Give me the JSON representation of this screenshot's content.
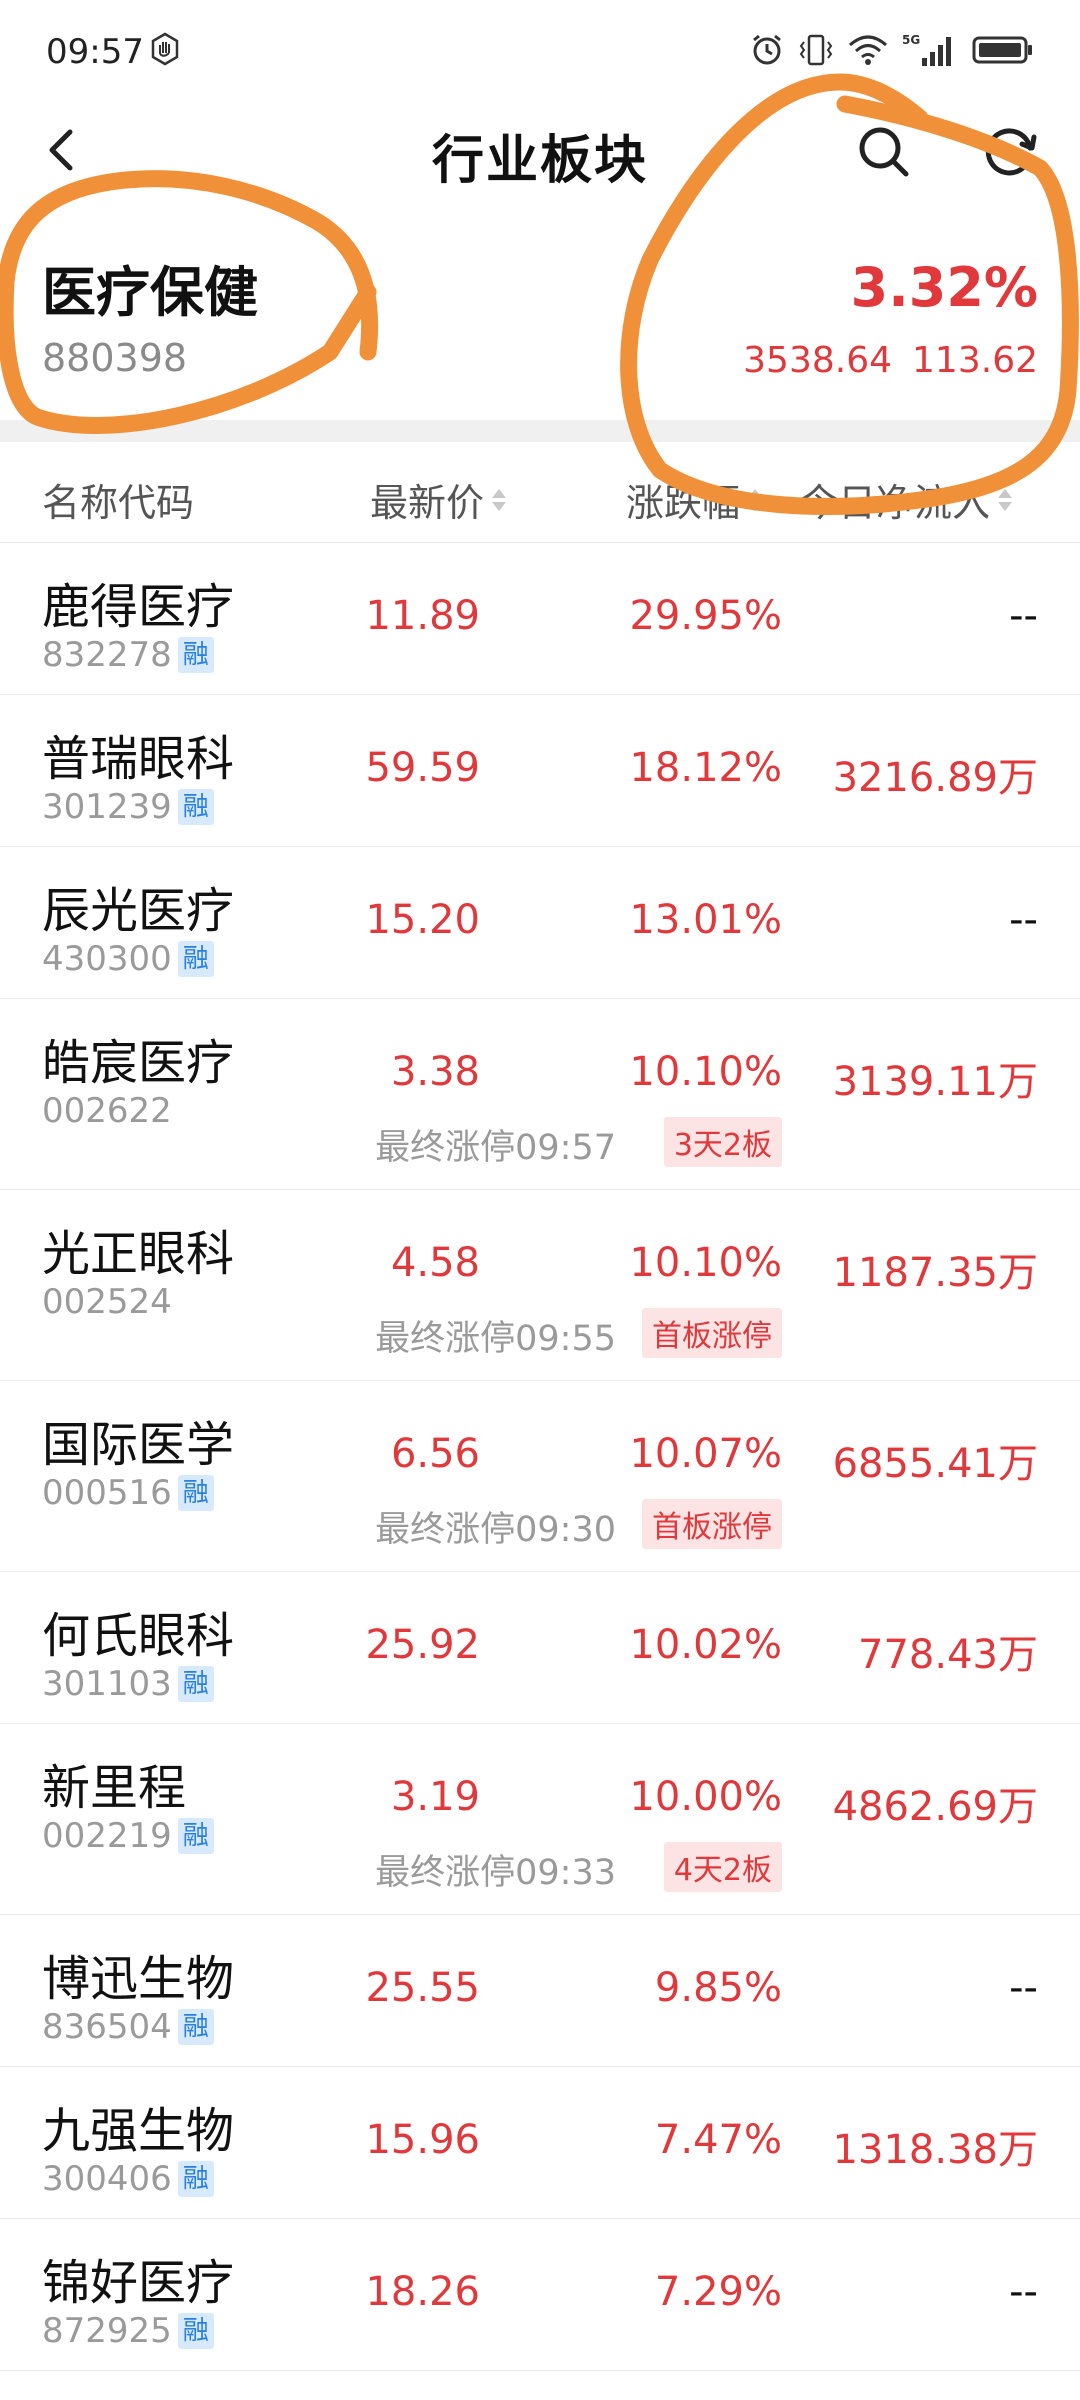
{
  "status_bar": {
    "time": "09:57",
    "icons": [
      "hand-icon",
      "alarm-icon",
      "vibrate-icon",
      "wifi-icon",
      "signal-5g-icon",
      "battery-icon"
    ]
  },
  "nav": {
    "title": "行业板块",
    "icons": {
      "back": "chevron-left-icon",
      "search": "search-icon",
      "refresh": "refresh-icon"
    }
  },
  "sector": {
    "name": "医疗保健",
    "code": "880398",
    "change_pct": "3.32%",
    "price": "3538.64",
    "change": "113.62"
  },
  "table_header": {
    "name_code": "名称代码",
    "latest_price": "最新价",
    "change_pct": "涨跌幅",
    "net_inflow": "今日净流入"
  },
  "rows": [
    {
      "name": "鹿得医疗",
      "code": "832278",
      "badge": "融",
      "price": "11.89",
      "pct": "29.95%",
      "flow": "--"
    },
    {
      "name": "普瑞眼科",
      "code": "301239",
      "badge": "融",
      "price": "59.59",
      "pct": "18.12%",
      "flow": "3216.89万"
    },
    {
      "name": "辰光医疗",
      "code": "430300",
      "badge": "融",
      "price": "15.20",
      "pct": "13.01%",
      "flow": "--"
    },
    {
      "name": "皓宸医疗",
      "code": "002622",
      "badge": "",
      "price": "3.38",
      "pct": "10.10%",
      "flow": "3139.11万",
      "note": "最终涨停09:57",
      "tag": "3天2板"
    },
    {
      "name": "光正眼科",
      "code": "002524",
      "badge": "",
      "price": "4.58",
      "pct": "10.10%",
      "flow": "1187.35万",
      "note": "最终涨停09:55",
      "tag": "首板涨停"
    },
    {
      "name": "国际医学",
      "code": "000516",
      "badge": "融",
      "price": "6.56",
      "pct": "10.07%",
      "flow": "6855.41万",
      "note": "最终涨停09:30",
      "tag": "首板涨停"
    },
    {
      "name": "何氏眼科",
      "code": "301103",
      "badge": "融",
      "price": "25.92",
      "pct": "10.02%",
      "flow": "778.43万"
    },
    {
      "name": "新里程",
      "code": "002219",
      "badge": "融",
      "price": "3.19",
      "pct": "10.00%",
      "flow": "4862.69万",
      "note": "最终涨停09:33",
      "tag": "4天2板"
    },
    {
      "name": "博迅生物",
      "code": "836504",
      "badge": "融",
      "price": "25.55",
      "pct": "9.85%",
      "flow": "--"
    },
    {
      "name": "九强生物",
      "code": "300406",
      "badge": "融",
      "price": "15.96",
      "pct": "7.47%",
      "flow": "1318.38万"
    },
    {
      "name": "锦好医疗",
      "code": "872925",
      "badge": "融",
      "price": "18.26",
      "pct": "7.29%",
      "flow": "--"
    }
  ],
  "colors": {
    "up": "#e0383b",
    "annotation": "#f0913a",
    "badge_bg": "#d7eafc",
    "badge_text": "#2a7fe0",
    "sort_active": "#2a92e8"
  }
}
